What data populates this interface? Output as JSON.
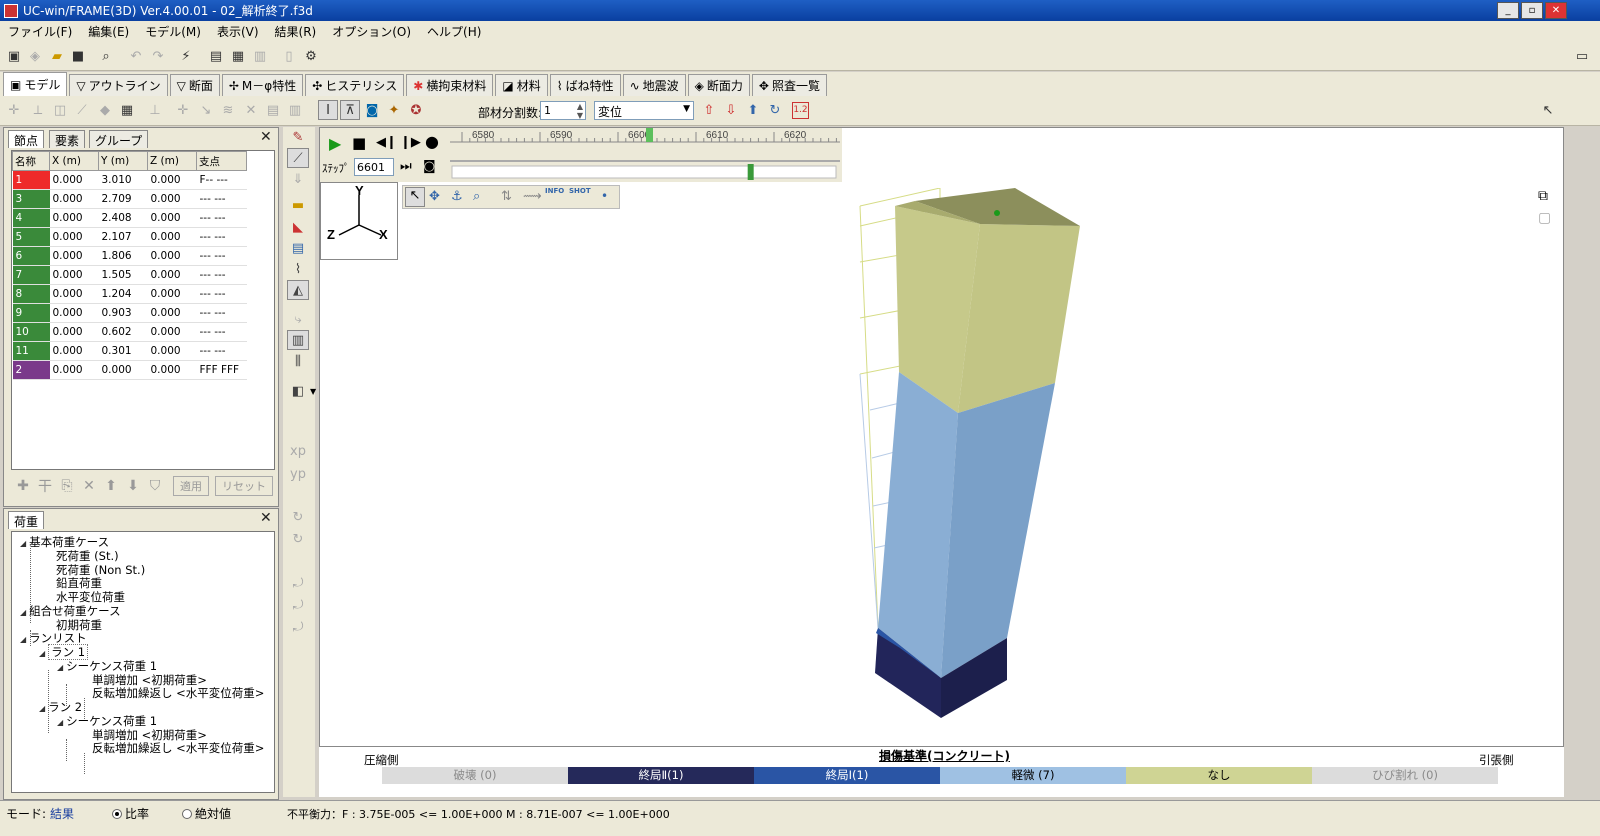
{
  "window": {
    "title": "UC-win/FRAME(3D) Ver.4.00.01 - 02_解析終了.f3d",
    "buttons": [
      "_",
      "▫",
      "✕"
    ]
  },
  "menu": [
    "ファイル(F)",
    "編集(E)",
    "モデル(M)",
    "表示(V)",
    "結果(R)",
    "オプション(O)",
    "ヘルプ(H)"
  ],
  "tabs": [
    {
      "label": "モデル",
      "icon": "model-icon",
      "active": true
    },
    {
      "label": "アウトライン",
      "icon": "outline-icon"
    },
    {
      "label": "断面",
      "icon": "section-icon"
    },
    {
      "label": "M－φ特性",
      "icon": "m-phi-icon"
    },
    {
      "label": "ヒステリシス",
      "icon": "hysteresis-icon"
    },
    {
      "label": "横拘束材料",
      "icon": "confined-material-icon"
    },
    {
      "label": "材料",
      "icon": "material-icon"
    },
    {
      "label": "ばね特性",
      "icon": "spring-icon"
    },
    {
      "label": "地震波",
      "icon": "wave-icon"
    },
    {
      "label": "断面力",
      "icon": "section-force-icon"
    },
    {
      "label": "照査一覧",
      "icon": "check-list-icon"
    }
  ],
  "toolbar2": {
    "division_label": "部材分割数:",
    "division_value": "1",
    "result_select": "変位",
    "scale_label": "1.2"
  },
  "node_panel": {
    "tabs": [
      "節点",
      "要素",
      "グループ"
    ],
    "columns": [
      "名称",
      "X (m)",
      "Y (m)",
      "Z (m)",
      "支点"
    ],
    "rows": [
      {
        "id": "1",
        "x": "0.000",
        "y": "3.010",
        "z": "0.000",
        "support": "F-- ---",
        "color": "#ee2a2a"
      },
      {
        "id": "3",
        "x": "0.000",
        "y": "2.709",
        "z": "0.000",
        "support": "--- ---",
        "color": "#3a8a3a"
      },
      {
        "id": "4",
        "x": "0.000",
        "y": "2.408",
        "z": "0.000",
        "support": "--- ---",
        "color": "#3a8a3a"
      },
      {
        "id": "5",
        "x": "0.000",
        "y": "2.107",
        "z": "0.000",
        "support": "--- ---",
        "color": "#3a8a3a"
      },
      {
        "id": "6",
        "x": "0.000",
        "y": "1.806",
        "z": "0.000",
        "support": "--- ---",
        "color": "#3a8a3a"
      },
      {
        "id": "7",
        "x": "0.000",
        "y": "1.505",
        "z": "0.000",
        "support": "--- ---",
        "color": "#3a8a3a"
      },
      {
        "id": "8",
        "x": "0.000",
        "y": "1.204",
        "z": "0.000",
        "support": "--- ---",
        "color": "#3a8a3a"
      },
      {
        "id": "9",
        "x": "0.000",
        "y": "0.903",
        "z": "0.000",
        "support": "--- ---",
        "color": "#3a8a3a"
      },
      {
        "id": "10",
        "x": "0.000",
        "y": "0.602",
        "z": "0.000",
        "support": "--- ---",
        "color": "#3a8a3a"
      },
      {
        "id": "11",
        "x": "0.000",
        "y": "0.301",
        "z": "0.000",
        "support": "--- ---",
        "color": "#3a8a3a"
      },
      {
        "id": "2",
        "x": "0.000",
        "y": "0.000",
        "z": "0.000",
        "support": "FFF FFF",
        "color": "#7a3a8a"
      }
    ],
    "apply_label": "適用",
    "reset_label": "リセット"
  },
  "load_panel": {
    "title": "荷重",
    "nodes": [
      {
        "label": "基本荷重ケース"
      },
      {
        "label": "死荷重 (St.)"
      },
      {
        "label": "死荷重 (Non St.)"
      },
      {
        "label": "鉛直荷重"
      },
      {
        "label": "水平変位荷重"
      },
      {
        "label": "組合せ荷重ケース"
      },
      {
        "label": "初期荷重"
      },
      {
        "label": "ランリスト"
      },
      {
        "label": "ラン 1"
      },
      {
        "label": "シーケンス荷重 1"
      },
      {
        "label": "単調増加 <初期荷重>"
      },
      {
        "label": "反転増加繰返し <水平変位荷重>"
      },
      {
        "label": "ラン 2"
      },
      {
        "label": "シーケンス荷重 1"
      },
      {
        "label": "単調増加 <初期荷重>"
      },
      {
        "label": "反転増加繰返し <水平変位荷重>"
      }
    ]
  },
  "animation": {
    "timeline_ticks": [
      "6580",
      "6590",
      "6600",
      "6610",
      "6620"
    ],
    "step_label": "ｽﾃｯﾌﾟ",
    "step_value": "6601",
    "slider_fraction": 0.77
  },
  "axes": {
    "y": "Y",
    "z": "Z",
    "x": "X"
  },
  "legend": {
    "title": "損傷基準(コンクリート)",
    "left_label": "圧縮側",
    "right_label": "引張側",
    "items": [
      {
        "label": "破壊 (0)",
        "color": "#dcdcdc",
        "text_color": "#8a8a8a"
      },
      {
        "label": "終局Ⅱ(1)",
        "color": "#25295a",
        "text_color": "#ffffff"
      },
      {
        "label": "終局Ⅰ(1)",
        "color": "#2a55a5",
        "text_color": "#ffffff"
      },
      {
        "label": "軽微 (7)",
        "color": "#9fc1e3",
        "text_color": "#000000"
      },
      {
        "label": "なし",
        "color": "#cfd494",
        "text_color": "#000000"
      },
      {
        "label": "ひび割れ (0)",
        "color": "#dcdcdc",
        "text_color": "#8a8a8a"
      }
    ]
  },
  "status": {
    "mode_label": "モード:",
    "mode_value": "結果",
    "radio_ratio": "比率",
    "radio_absolute": "絶対値",
    "residual": "不平衡力：F : 3.75E-005 <= 1.00E+000 M : 8.71E-007 <= 1.00E+000"
  },
  "colors": {
    "titlebar": "#0a3fa0",
    "upper_column": "#c6c98a",
    "middle_column": "#8aaed4",
    "base_column": "#22255a"
  }
}
